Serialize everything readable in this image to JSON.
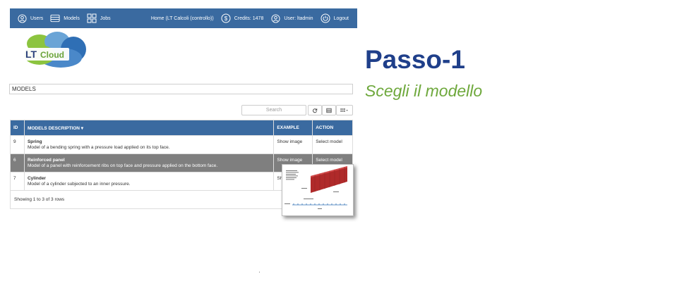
{
  "nav": {
    "users": "Users",
    "models": "Models",
    "jobs": "Jobs",
    "home": "Home (LT Calcoli (controllo))",
    "credits": "Credits: 1478",
    "user": "User: ltadmin",
    "logout": "Logout"
  },
  "logo": {
    "text_lt": "LT",
    "text_cloud": "Cloud"
  },
  "section": {
    "title": "MODELS"
  },
  "toolbar": {
    "search_placeholder": "Search"
  },
  "table": {
    "headers": {
      "id": "ID",
      "desc": "MODELS DESCRIPTION ▾",
      "example": "EXAMPLE",
      "action": "ACTION"
    },
    "rows": [
      {
        "id": "9",
        "title": "Spring",
        "desc": "Model of a bending spring with a pressure load applied on its top face.",
        "example": "Show image",
        "action": "Select model"
      },
      {
        "id": "6",
        "title": "Reinforced panel",
        "desc": "Model of a panel with reinforcement ribs on top face and pressure applied on the bottom face.",
        "example": "Show image",
        "action": "Select model"
      },
      {
        "id": "7",
        "title": "Cylinder",
        "desc": "Model of a cylinder subjected to an inner pressure.",
        "example": "Sh",
        "action": ""
      }
    ],
    "footer": "Showing 1 to 3 of 3 rows"
  },
  "side": {
    "title": "Passo-1",
    "subtitle": "Scegli il modello"
  },
  "colors": {
    "nav": "#3a6aa0",
    "title": "#1f3f8a",
    "subtitle": "#6ea83c",
    "selected_row": "#7f7f7f"
  }
}
